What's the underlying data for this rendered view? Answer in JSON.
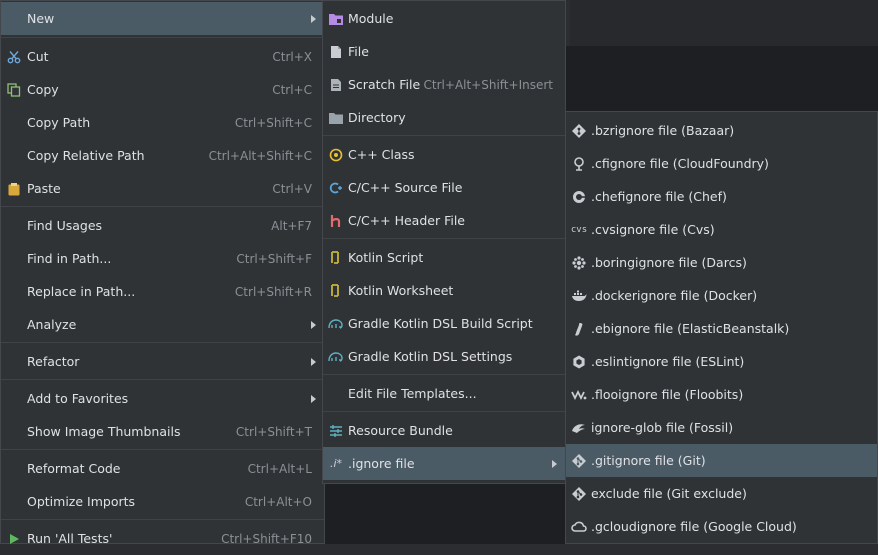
{
  "main_menu": {
    "items": [
      {
        "label": "New",
        "shortcut": "",
        "submenu": true
      },
      {
        "label": "Cut",
        "shortcut": "Ctrl+X"
      },
      {
        "label": "Copy",
        "shortcut": "Ctrl+C"
      },
      {
        "label": "Copy Path",
        "shortcut": "Ctrl+Shift+C"
      },
      {
        "label": "Copy Relative Path",
        "shortcut": "Ctrl+Alt+Shift+C"
      },
      {
        "label": "Paste",
        "shortcut": "Ctrl+V"
      },
      {
        "label": "Find Usages",
        "shortcut": "Alt+F7"
      },
      {
        "label": "Find in Path...",
        "shortcut": "Ctrl+Shift+F"
      },
      {
        "label": "Replace in Path...",
        "shortcut": "Ctrl+Shift+R"
      },
      {
        "label": "Analyze",
        "shortcut": "",
        "submenu": true
      },
      {
        "label": "Refactor",
        "shortcut": "",
        "submenu": true
      },
      {
        "label": "Add to Favorites",
        "shortcut": "",
        "submenu": true
      },
      {
        "label": "Show Image Thumbnails",
        "shortcut": "Ctrl+Shift+T"
      },
      {
        "label": "Reformat Code",
        "shortcut": "Ctrl+Alt+L"
      },
      {
        "label": "Optimize Imports",
        "shortcut": "Ctrl+Alt+O"
      },
      {
        "label": "Run 'All Tests'",
        "shortcut": "Ctrl+Shift+F10"
      }
    ]
  },
  "new_menu": {
    "items": [
      {
        "label": "Module"
      },
      {
        "label": "File"
      },
      {
        "label": "Scratch File",
        "shortcut": "Ctrl+Alt+Shift+Insert"
      },
      {
        "label": "Directory"
      },
      {
        "label": "C++ Class"
      },
      {
        "label": "C/C++ Source File"
      },
      {
        "label": "C/C++ Header File"
      },
      {
        "label": "Kotlin Script"
      },
      {
        "label": "Kotlin Worksheet"
      },
      {
        "label": "Gradle Kotlin DSL Build Script"
      },
      {
        "label": "Gradle Kotlin DSL Settings"
      },
      {
        "label": "Edit File Templates..."
      },
      {
        "label": "Resource Bundle"
      },
      {
        "label": ".ignore file",
        "icon_text": ".i*",
        "submenu": true
      }
    ]
  },
  "ignore_menu": {
    "items": [
      {
        "label": ".bzrignore file (Bazaar)"
      },
      {
        "label": ".cfignore file (CloudFoundry)"
      },
      {
        "label": ".chefignore file (Chef)"
      },
      {
        "label": ".cvsignore file (Cvs)",
        "icon_text": "cvs"
      },
      {
        "label": ".boringignore file (Darcs)"
      },
      {
        "label": ".dockerignore file (Docker)"
      },
      {
        "label": ".ebignore file (ElasticBeanstalk)"
      },
      {
        "label": ".eslintignore file (ESLint)"
      },
      {
        "label": ".flooignore file (Floobits)"
      },
      {
        "label": "ignore-glob file (Fossil)"
      },
      {
        "label": ".gitignore file (Git)"
      },
      {
        "label": "exclude file (Git exclude)"
      },
      {
        "label": ".gcloudignore file (Google Cloud)"
      }
    ]
  },
  "colors": {
    "menu_bg": "#2f3336",
    "selection": "#4b5b66",
    "text": "#dfe1e5",
    "shortcut": "#8c9095",
    "cpp_icon": "#e8c230",
    "header_icon": "#e06c6c",
    "kotlin_icon": "#c8b23a",
    "gradle_icon": "#5fb1c4",
    "module_icon": "#b58be6"
  }
}
